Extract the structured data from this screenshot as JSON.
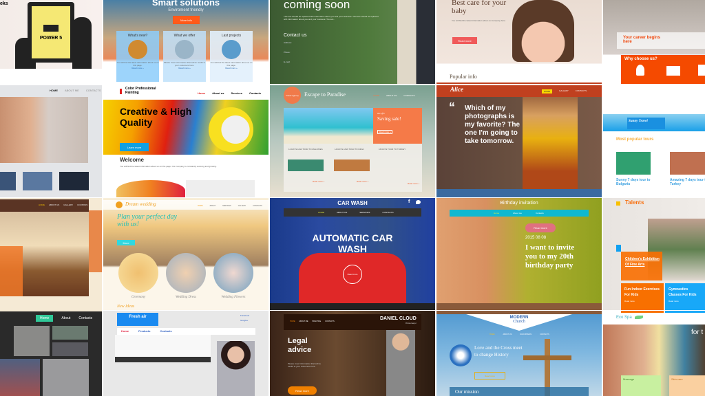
{
  "colors": {
    "orange": "#ff6a1a",
    "teal": "#3dd9c9",
    "rust": "#c0401f",
    "blue": "#28a8e8",
    "green_dark": "#3c5a30"
  },
  "t_power": {
    "partial": "eks",
    "label": "POWER 5"
  },
  "t_smart": {
    "title": "Smart solutions",
    "subtitle": "Enviroment friendly",
    "button": "More info",
    "cards": [
      "What's new?",
      "What we offer",
      "Last projects"
    ],
    "read": "Read more »"
  },
  "t_coming": {
    "title": "coming soon",
    "text": "This text should be replaced with information about you and your business. This text should be replaced with information about you and your business.This text...",
    "contact": "Contact us",
    "lines": [
      "Address:",
      "Phone:",
      "E-mail:"
    ]
  },
  "t_baby": {
    "title": "Best care for your baby",
    "text": "You will find the latest information about our company here.",
    "button": "Read more",
    "popular": "Popular info"
  },
  "t_career": {
    "title": "Your career begins here",
    "why": "Why choose us?"
  },
  "t_man": {
    "nav": [
      "HOME",
      "ABOUT ME",
      "CONTACTS"
    ]
  },
  "t_paint": {
    "logo": "Color Professional Painting",
    "nav": [
      "Home",
      "About us",
      "Services",
      "Contacts"
    ],
    "hero": "Creative & High Quality",
    "button": "Learn more",
    "welcome": "Welcome"
  },
  "t_paradise": {
    "badge": "Travel agency",
    "title": "Escape to Paradise",
    "nav": [
      "HOME",
      "ABOUT US",
      "CONTACTS"
    ],
    "hot": "Hot offer",
    "sale": "Saving sale!",
    "read": "Read more »",
    "tours": [
      "12 DAYS ASIA TOUR TO MALDIVES",
      "14 DAYS ASIA TOUR TO INDIA",
      "16 DAYS TOUR TO TURKEY"
    ]
  },
  "t_alice": {
    "logo": "Alice",
    "nav": [
      "HOME",
      "GALLERY",
      "CONTACTS"
    ],
    "quote": "Which of my photographs is my favorite? The one I'm going to take tomorrow."
  },
  "t_sunny": {
    "logo": "Sunny Travel",
    "heading": "Most popular tours",
    "tours": [
      "Sunny 7 days tour to Bulgaria",
      "Amazing 7 days tour to Turkey"
    ]
  },
  "t_soap": {
    "nav": [
      "HOME",
      "ABOUT US",
      "GALLERY",
      "COUPONS"
    ]
  },
  "t_wedding": {
    "logo": "Dream wedding",
    "nav": [
      "HOME",
      "ABOUT",
      "SERVICES",
      "GALLERY",
      "CONTACTS"
    ],
    "hero": "Plan your perfect day with us!",
    "button": "More",
    "items": [
      "Ceremony",
      "Wedding Dress",
      "Wedding Flowers"
    ],
    "ideas": "New Ideas"
  },
  "t_carwash": {
    "title": "CAR WASH",
    "nav": [
      "HOME",
      "ABOUT US",
      "SERVICES",
      "CONTACTS"
    ],
    "hero": "AUTOMATIC CAR WASH",
    "button": "Read more"
  },
  "t_birthday": {
    "title": "Birthday invitation",
    "nav": [
      "Home",
      "About me",
      "Contacts"
    ],
    "button": "Read more",
    "date": "2015 08 08",
    "hero": "I want to invite you to my 20th birthday party"
  },
  "t_talents": {
    "logo": "Talents",
    "feature": "Children's Exhibition Of Fine Arts",
    "boxes": [
      "Fun Indoor Exercises For Kids",
      "Gymnastics Classes For Kids"
    ],
    "read": "Read more"
  },
  "t_photo": {
    "nav": [
      "Home",
      "About",
      "Contacts"
    ]
  },
  "t_air": {
    "logo": "Fresh air",
    "social": [
      "Facebook",
      "Google+"
    ],
    "nav": [
      "Home",
      "Products",
      "Contacts"
    ]
  },
  "t_lawyer": {
    "name": "DANIEL CLOUD",
    "sub": "Private lawyer",
    "nav": [
      "HOME",
      "ABOUT ME",
      "PRACTICE",
      "CONTACTS"
    ],
    "hero": "Legal advice",
    "button": "Read more"
  },
  "t_church": {
    "logo1": "MODERN",
    "logo2": "Church",
    "nav": [
      "HOME",
      "ABOUT US",
      "OUR MISSION",
      "CONTACTS"
    ],
    "hero": "Love and the Cross meet to change History",
    "button": "Read more",
    "mission": "Our mission"
  },
  "t_spa": {
    "logo": "Eco Spa",
    "hero": "for t",
    "cards": [
      "Massage",
      "Skin care"
    ]
  }
}
